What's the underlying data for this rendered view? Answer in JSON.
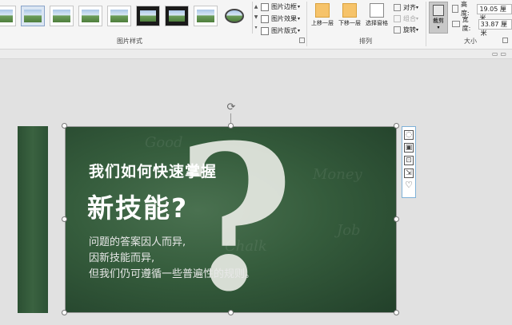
{
  "ribbon": {
    "picture_styles": {
      "label": "图片样式",
      "border": "图片边框",
      "effects": "图片效果",
      "layout": "图片版式",
      "thumbnails": [
        "style-simple-frame",
        "style-shadow",
        "style-reflect-1",
        "style-reflect-2",
        "style-soft-edge",
        "style-black-frame",
        "style-thick-black",
        "style-metal",
        "style-oval"
      ]
    },
    "arrange": {
      "label": "排列",
      "bring_forward": "上移一层",
      "send_backward": "下移一层",
      "selection_pane": "选择窗格",
      "align": "对齐",
      "group": "组合",
      "rotate": "旋转"
    },
    "size": {
      "label": "大小",
      "crop": "裁剪",
      "height_label": "高度:",
      "height_value": "19.05 厘米",
      "width_label": "宽度:",
      "width_value": "33.87 厘米"
    }
  },
  "slide": {
    "title_line1": "我们如何快速掌握",
    "title_line2": "新技能?",
    "body": [
      "问题的答案因人而异,",
      "因新技能而异,",
      "但我们仍可遵循一些普遍性的规则。"
    ],
    "question_mark": "?"
  },
  "colors": {
    "chalkboard": "#355c3c",
    "ribbon_bg": "#f5f5f5",
    "workspace_bg": "#e1e1e1"
  }
}
